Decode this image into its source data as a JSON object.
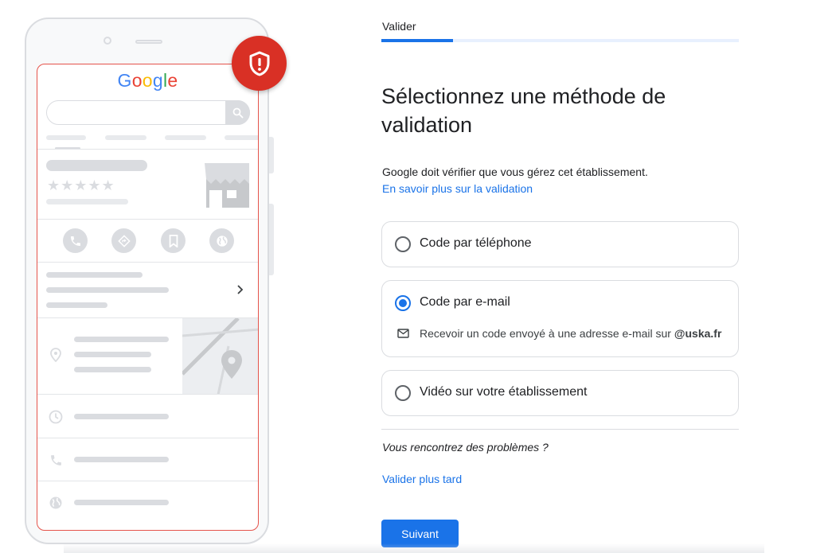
{
  "phone": {
    "logo": {
      "letters": [
        "G",
        "o",
        "o",
        "g",
        "l",
        "e"
      ],
      "colors": [
        "#4285f4",
        "#ea4335",
        "#fbbc05",
        "#4285f4",
        "#34a853",
        "#ea4335"
      ]
    },
    "badge_icon": "shield-alert-icon",
    "action_icons": [
      "phone-icon",
      "directions-icon",
      "bookmark-icon",
      "globe-icon"
    ],
    "row_icons": [
      "location-pin-icon",
      "clock-icon",
      "phone-icon",
      "globe-icon"
    ]
  },
  "stepper": {
    "label": "Valider",
    "progress": 0.2
  },
  "heading": "Sélectionnez une méthode de validation",
  "description": "Google doit vérifier que vous gérez cet établissement.",
  "learn_more": "En savoir plus sur la validation",
  "options": [
    {
      "label": "Code par téléphone",
      "selected": false
    },
    {
      "label": "Code par e-mail",
      "selected": true,
      "sub_text": "Recevoir un code envoyé à une adresse e-mail sur ",
      "sub_domain": "@uska.fr",
      "sub_icon": "mail-icon"
    },
    {
      "label": "Vidéo sur votre établissement",
      "selected": false
    }
  ],
  "trouble": "Vous rencontrez des problèmes ?",
  "later_link": "Valider plus tard",
  "next_button": "Suivant",
  "colors": {
    "accent": "#1a73e8",
    "badge": "#d93025",
    "frame_outline": "#e5534b"
  }
}
